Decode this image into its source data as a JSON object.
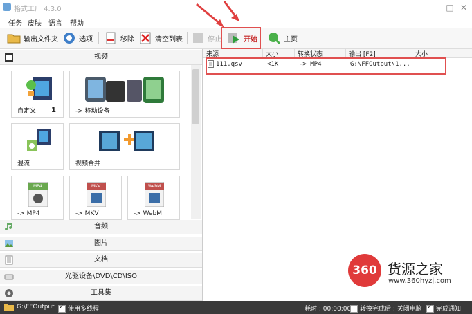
{
  "window": {
    "title": "格式工厂 4.3.0",
    "minimize": "–",
    "maximize": "□",
    "close": "✕"
  },
  "menu": [
    "任务",
    "皮肤",
    "语言",
    "帮助"
  ],
  "toolbar": {
    "output_folder": "输出文件夹",
    "options": "选项",
    "remove": "移除",
    "clear_list": "清空列表",
    "stop": "停止",
    "start": "开始",
    "home": "主页"
  },
  "sidebar": {
    "video_header": "视频",
    "tiles": [
      {
        "label": "自定义",
        "count": "1"
      },
      {
        "label": "-> 移动设备"
      },
      {
        "label": "混流"
      },
      {
        "label": "视频合并"
      },
      {
        "label": "-> MP4",
        "badge": "MP4"
      },
      {
        "label": "-> MKV",
        "badge": "MKV"
      },
      {
        "label": "-> WebM",
        "badge": "WebM"
      }
    ],
    "categories": [
      "音频",
      "图片",
      "文档",
      "光驱设备\\DVD\\CD\\ISO",
      "工具集"
    ]
  },
  "filelist": {
    "columns": [
      "来源",
      "大小",
      "转换状态",
      "输出 [F2]",
      "大小"
    ],
    "rows": [
      {
        "source": "111.qsv",
        "size": "<1K",
        "status": "-> MP4",
        "output": "G:\\FFOutput\\1..."
      }
    ]
  },
  "statusbar": {
    "output_path": "G:\\FFOutput",
    "multithread": "使用多线程",
    "elapsed": "耗时 : 00:00:00",
    "after_convert": "转换完成后 : 关闭电脑",
    "notify": "完成通知"
  },
  "watermark": {
    "logo": "360",
    "name": "货源之家",
    "url": "www.360hyzj.com"
  },
  "colors": {
    "highlight": "#e05050",
    "statusbar_bg": "#3a3a3a",
    "watermark_red": "#e03a3a"
  }
}
